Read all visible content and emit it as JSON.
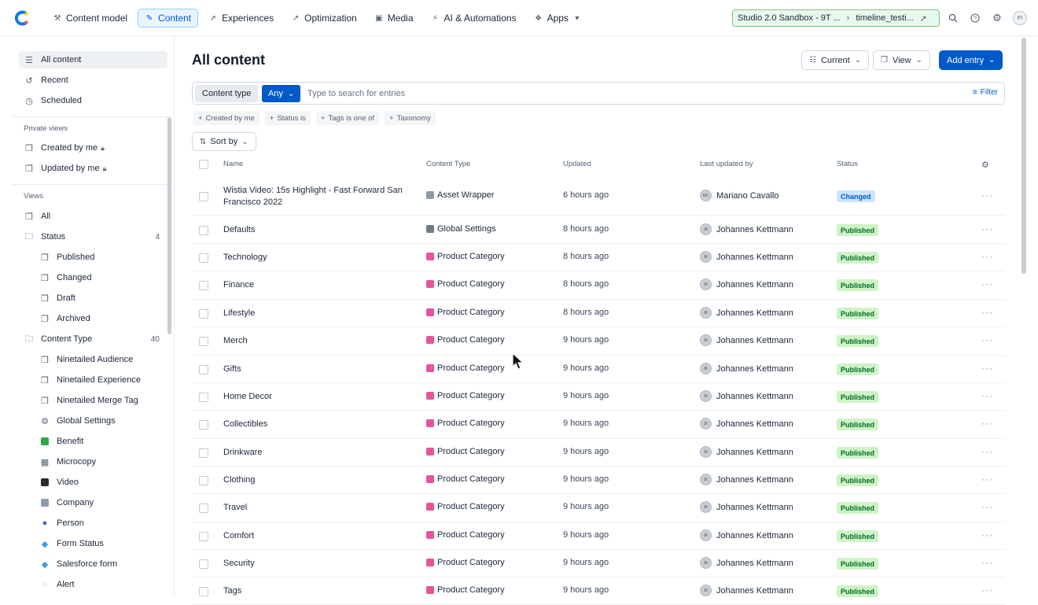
{
  "nav": {
    "items": [
      {
        "label": "Content model",
        "icon": "wrench-icon"
      },
      {
        "label": "Content",
        "icon": "pencil-icon",
        "active": true
      },
      {
        "label": "Experiences",
        "icon": "rocket-icon"
      },
      {
        "label": "Optimization",
        "icon": "trend-icon"
      },
      {
        "label": "Media",
        "icon": "image-icon"
      },
      {
        "label": "AI & Automations",
        "icon": "bolt-icon"
      },
      {
        "label": "Apps",
        "icon": "puzzle-icon"
      }
    ],
    "env_space": "Studio 2.0 Sandbox - 9T ...",
    "env_branch": "timeline_testi...",
    "user_initials": "FI"
  },
  "sidebar": {
    "top": [
      "All content",
      "Recent",
      "Scheduled"
    ],
    "private_views_heading": "Private views",
    "private_views": [
      "Created by me",
      "Updated by me"
    ],
    "views_heading": "Views",
    "all_label": "All",
    "status_label": "Status",
    "status_count": "4",
    "status_items": [
      "Published",
      "Changed",
      "Draft",
      "Archived"
    ],
    "content_type_label": "Content Type",
    "content_type_count": "40",
    "content_types": [
      {
        "label": "Ninetailed Audience",
        "icon": "bookmark-icon"
      },
      {
        "label": "Ninetailed Experience",
        "icon": "bookmark-icon"
      },
      {
        "label": "Ninetailed Merge Tag",
        "icon": "bookmark-icon"
      },
      {
        "label": "Global Settings",
        "icon": "gear-icon"
      },
      {
        "label": "Benefit",
        "icon": "checkbox-icon"
      },
      {
        "label": "Microcopy",
        "icon": "grid-icon"
      },
      {
        "label": "Video",
        "icon": "clapper-icon"
      },
      {
        "label": "Company",
        "icon": "building-icon"
      },
      {
        "label": "Person",
        "icon": "person-icon"
      },
      {
        "label": "Form Status",
        "icon": "diamond-icon"
      },
      {
        "label": "Salesforce form",
        "icon": "diamond-icon"
      },
      {
        "label": "Alert",
        "icon": "speech-icon"
      }
    ]
  },
  "main": {
    "title": "All content",
    "current_label": "Current",
    "view_label": "View",
    "add_entry_label": "Add entry",
    "content_type_label": "Content type",
    "any_label": "Any",
    "search_placeholder": "Type to search for entries",
    "filter_label": "Filter",
    "chips": [
      "Created by me",
      "Status is",
      "Tags is one of",
      "Taxonomy"
    ],
    "sort_label": "Sort by"
  },
  "table": {
    "columns": {
      "name": "Name",
      "type": "Content Type",
      "updated": "Updated",
      "user": "Last updated by",
      "status": "Status"
    },
    "rows": [
      {
        "name": "Wistia Video: 15s Highlight - Fast Forward San Francisco 2022",
        "type": "Asset Wrapper",
        "updated": "6 hours ago",
        "user": "Mariano Cavallo",
        "initials": "MC",
        "status": "Changed"
      },
      {
        "name": "Defaults",
        "type": "Global Settings",
        "updated": "8 hours ago",
        "user": "Johannes Kettmann",
        "initials": "JK",
        "status": "Published"
      },
      {
        "name": "Technology",
        "type": "Product Category",
        "updated": "8 hours ago",
        "user": "Johannes Kettmann",
        "initials": "JK",
        "status": "Published"
      },
      {
        "name": "Finance",
        "type": "Product Category",
        "updated": "8 hours ago",
        "user": "Johannes Kettmann",
        "initials": "JK",
        "status": "Published"
      },
      {
        "name": "Lifestyle",
        "type": "Product Category",
        "updated": "8 hours ago",
        "user": "Johannes Kettmann",
        "initials": "JK",
        "status": "Published"
      },
      {
        "name": "Merch",
        "type": "Product Category",
        "updated": "9 hours ago",
        "user": "Johannes Kettmann",
        "initials": "JK",
        "status": "Published"
      },
      {
        "name": "Gifts",
        "type": "Product Category",
        "updated": "9 hours ago",
        "user": "Johannes Kettmann",
        "initials": "JK",
        "status": "Published"
      },
      {
        "name": "Home Decor",
        "type": "Product Category",
        "updated": "9 hours ago",
        "user": "Johannes Kettmann",
        "initials": "JK",
        "status": "Published"
      },
      {
        "name": "Collectibles",
        "type": "Product Category",
        "updated": "9 hours ago",
        "user": "Johannes Kettmann",
        "initials": "JK",
        "status": "Published"
      },
      {
        "name": "Drinkware",
        "type": "Product Category",
        "updated": "9 hours ago",
        "user": "Johannes Kettmann",
        "initials": "JK",
        "status": "Published"
      },
      {
        "name": "Clothing",
        "type": "Product Category",
        "updated": "9 hours ago",
        "user": "Johannes Kettmann",
        "initials": "JK",
        "status": "Published"
      },
      {
        "name": "Travel",
        "type": "Product Category",
        "updated": "9 hours ago",
        "user": "Johannes Kettmann",
        "initials": "JK",
        "status": "Published"
      },
      {
        "name": "Comfort",
        "type": "Product Category",
        "updated": "9 hours ago",
        "user": "Johannes Kettmann",
        "initials": "JK",
        "status": "Published"
      },
      {
        "name": "Security",
        "type": "Product Category",
        "updated": "9 hours ago",
        "user": "Johannes Kettmann",
        "initials": "JK",
        "status": "Published"
      },
      {
        "name": "Tags",
        "type": "Product Category",
        "updated": "9 hours ago",
        "user": "Johannes Kettmann",
        "initials": "JK",
        "status": "Published"
      }
    ]
  },
  "colors": {
    "primary": "#0059c8",
    "published_bg": "#cdf3c6",
    "changed_bg": "#cbe4ff"
  }
}
